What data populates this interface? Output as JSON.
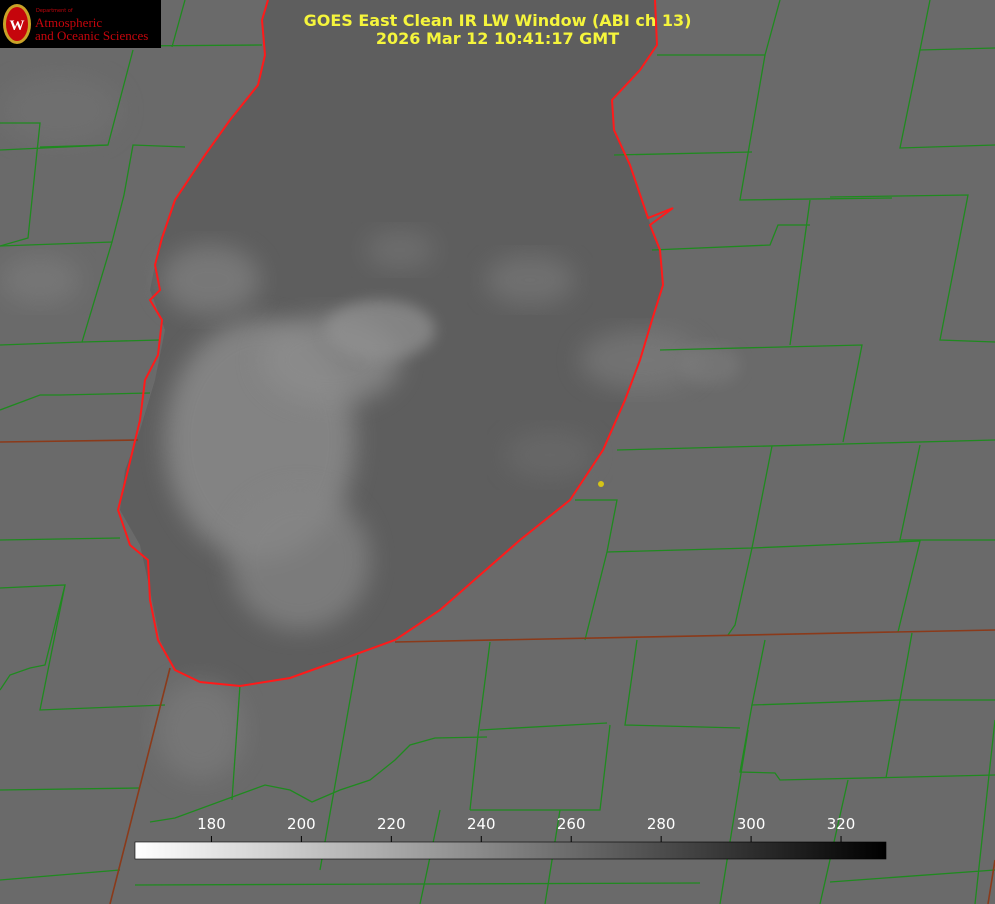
{
  "title": {
    "line1": "GOES East Clean IR LW Window (ABI ch 13)",
    "line2": "2026 Mar 12 10:41:17 GMT"
  },
  "logo": {
    "department": "Department of",
    "line1": "Atmospheric",
    "line2": "and Oceanic Sciences",
    "seal_letter": "W",
    "color": "#c5050c"
  },
  "colorbar": {
    "tick_labels": [
      "180",
      "200",
      "220",
      "240",
      "260",
      "280",
      "300",
      "320"
    ],
    "range": [
      163,
      330
    ],
    "colormap": "white-to-black"
  },
  "colors": {
    "title": "#f5f53c",
    "county_borders": "#1f8a1f",
    "coastline": "#ff1a1a",
    "state_borders": "#8b3a1a",
    "marker": "#d4c417"
  }
}
